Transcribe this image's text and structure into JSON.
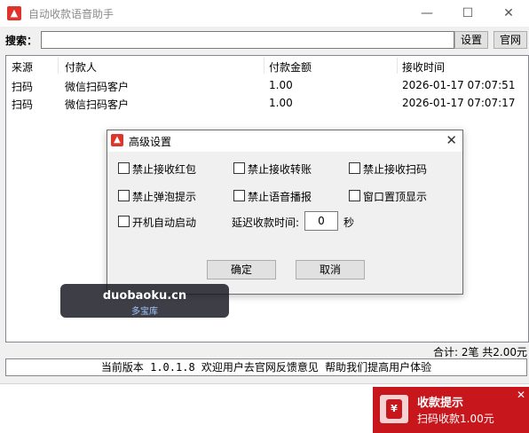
{
  "window": {
    "title": "自动收款语音助手",
    "minimize_glyph": "—",
    "maximize_glyph": "☐",
    "close_glyph": "✕"
  },
  "search": {
    "label": "搜索：",
    "value": "",
    "settings_label": "设置",
    "website_label": "官网"
  },
  "table": {
    "headers": [
      "来源",
      "付款人",
      "付款金额",
      "接收时间"
    ],
    "rows": [
      {
        "source": "扫码",
        "payer": "微信扫码客户",
        "amount": "1.00",
        "time": "2026-01-17 07:07:51"
      },
      {
        "source": "扫码",
        "payer": "微信扫码客户",
        "amount": "1.00",
        "time": "2026-01-17 07:07:17"
      }
    ]
  },
  "summary": "合计: 2笔 共2.00元",
  "footer": "当前版本 1.0.1.8 欢迎用户去官网反馈意见 帮助我们提高用户体验",
  "dialog": {
    "title": "高级设置",
    "close_glyph": "✕",
    "options": [
      {
        "label": "禁止接收红包",
        "checked": false
      },
      {
        "label": "禁止接收转账",
        "checked": false
      },
      {
        "label": "禁止接收扫码",
        "checked": false
      },
      {
        "label": "禁止弹泡提示",
        "checked": false
      },
      {
        "label": "禁止语音播报",
        "checked": false
      },
      {
        "label": "窗口置顶显示",
        "checked": false
      },
      {
        "label": "开机自动启动",
        "checked": false
      }
    ],
    "delay_label": "延迟收款时间:",
    "delay_value": "0",
    "delay_unit": "秒",
    "ok_label": "确定",
    "cancel_label": "取消"
  },
  "watermark": {
    "main": "duobaoku.cn",
    "sub": "多宝库"
  },
  "toast": {
    "title": "收款提示",
    "message": "扫码收款1.00元",
    "close_glyph": "✕",
    "icon_glyph": "¥"
  }
}
